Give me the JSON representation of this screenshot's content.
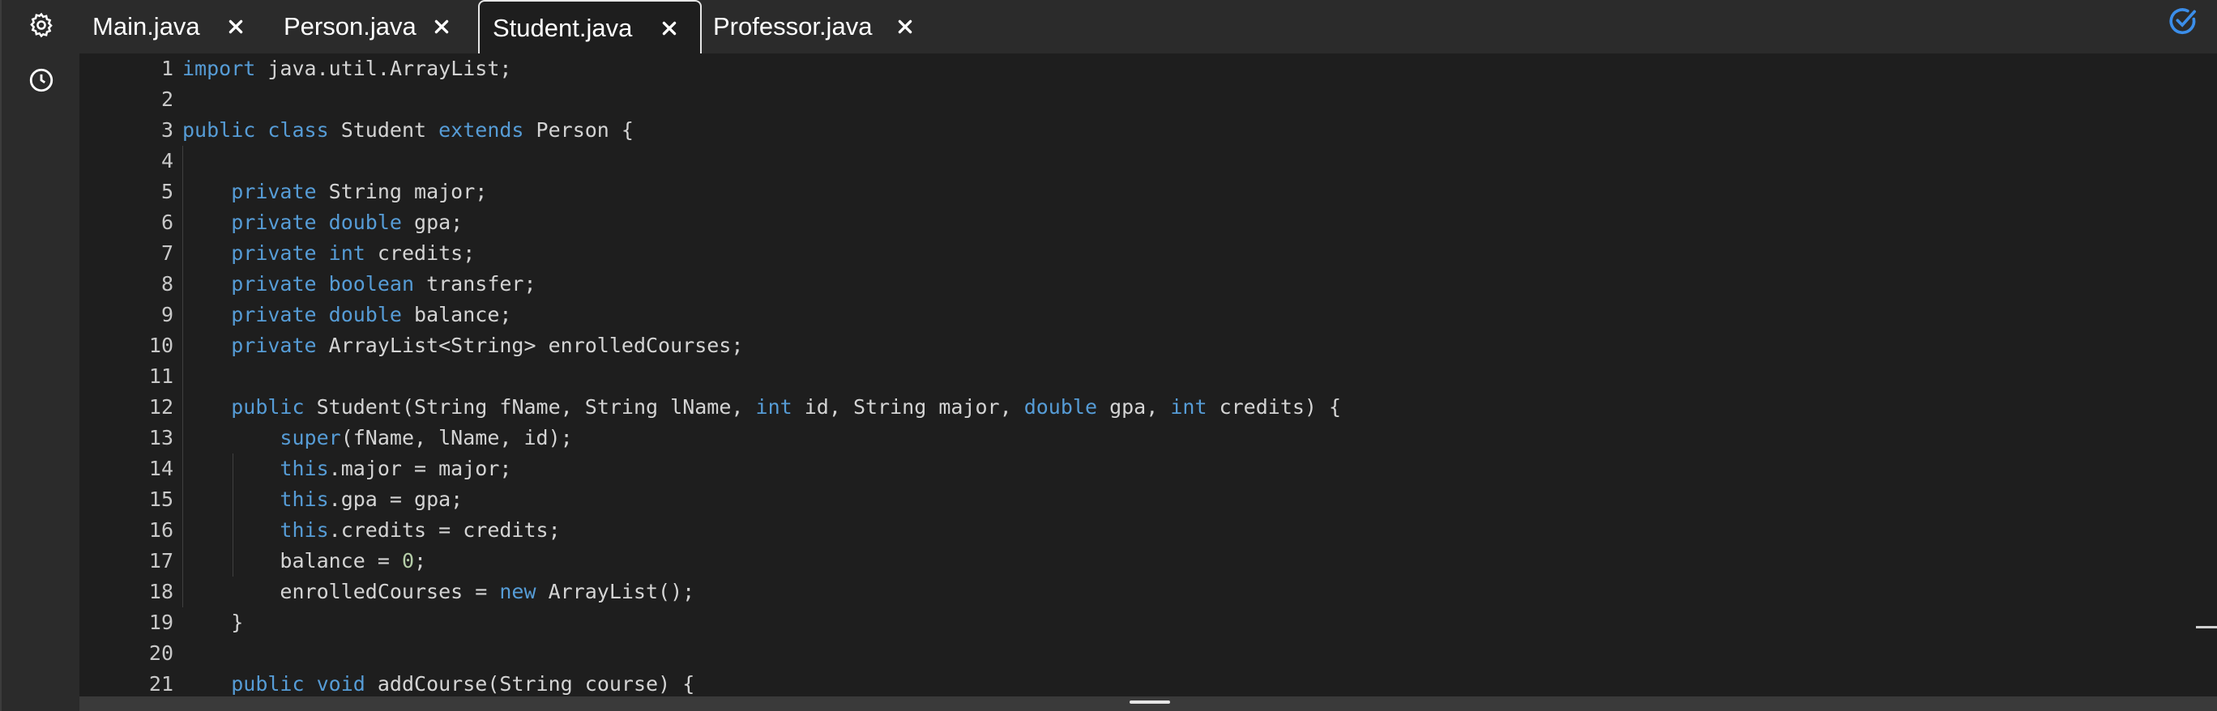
{
  "sidebar": {
    "settings_icon": "gear-icon",
    "history_icon": "clock-icon"
  },
  "tabs": [
    {
      "label": "Main.java",
      "active": false
    },
    {
      "label": "Person.java",
      "active": false
    },
    {
      "label": "Student.java",
      "active": true
    },
    {
      "label": "Professor.java",
      "active": false
    }
  ],
  "status": {
    "icon": "check-circle-icon",
    "color": "#3b8eea"
  },
  "colors": {
    "keyword": "#569cd6",
    "number": "#b5cea8",
    "text": "#d4d4d4",
    "background": "#1e1e1e"
  },
  "editor": {
    "line_numbers": [
      "1",
      "2",
      "3",
      "4",
      "5",
      "6",
      "7",
      "8",
      "9",
      "10",
      "11",
      "12",
      "13",
      "14",
      "15",
      "16",
      "17",
      "18",
      "19",
      "20",
      "21"
    ],
    "lines": [
      "import java.util.ArrayList;",
      "",
      "public class Student extends Person {",
      "",
      "    private String major;",
      "    private double gpa;",
      "    private int credits;",
      "    private boolean transfer;",
      "    private double balance;",
      "    private ArrayList<String> enrolledCourses;",
      "",
      "    public Student(String fName, String lName, int id, String major, double gpa, int credits) {",
      "        super(fName, lName, id);",
      "        this.major = major;",
      "        this.gpa = gpa;",
      "        this.credits = credits;",
      "        balance = 0;",
      "        enrolledCourses = new ArrayList();",
      "    }",
      "",
      "    public void addCourse(String course) {"
    ]
  }
}
